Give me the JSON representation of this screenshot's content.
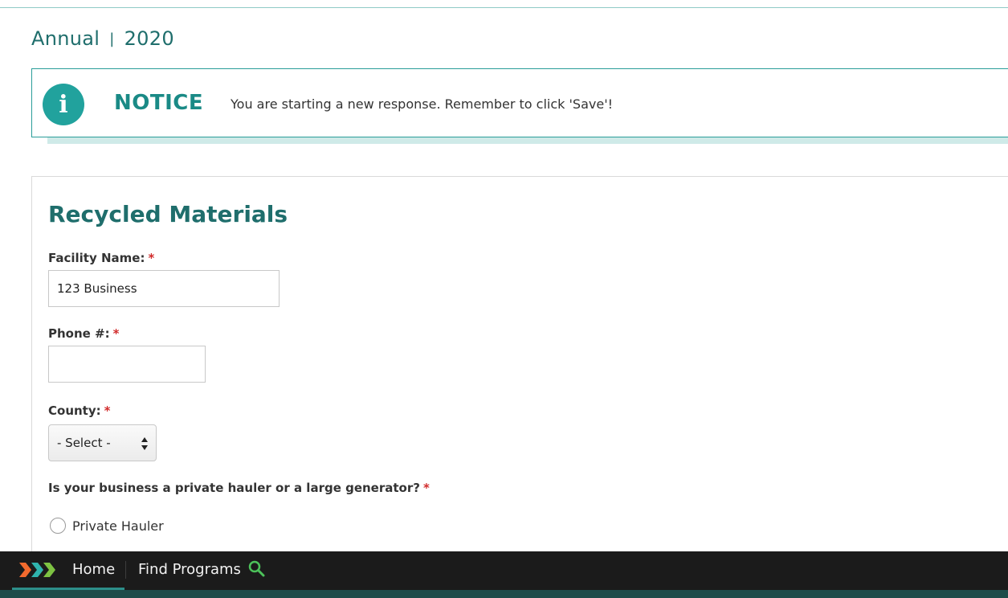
{
  "header": {
    "period": "Annual",
    "separator": "|",
    "year": "2020"
  },
  "notice": {
    "icon": "info-icon",
    "icon_glyph": "i",
    "title": "NOTICE",
    "message": "You are starting a new response. Remember to click 'Save'!"
  },
  "form": {
    "title": "Recycled Materials",
    "required_marker": "*",
    "facility_name": {
      "label": "Facility Name:",
      "value": "123 Business"
    },
    "phone": {
      "label": "Phone #:",
      "value": ""
    },
    "county": {
      "label": "County:",
      "selected": "- Select -"
    },
    "business_type": {
      "question": "Is your business a private hauler or a large generator?",
      "options": [
        "Private Hauler"
      ]
    }
  },
  "nav": {
    "home_label": "Home",
    "find_programs_label": "Find Programs",
    "search_icon": "search-icon",
    "logo": "chevrons-logo"
  },
  "colors": {
    "teal_primary": "#1f6e6c",
    "teal_accent": "#21a29d",
    "required_red": "#d12b2b",
    "nav_bg": "#1b1b1b",
    "search_green": "#4cc25a",
    "logo_orange": "#f26a2e",
    "logo_teal": "#2fb3ad",
    "logo_green": "#7dc242"
  }
}
